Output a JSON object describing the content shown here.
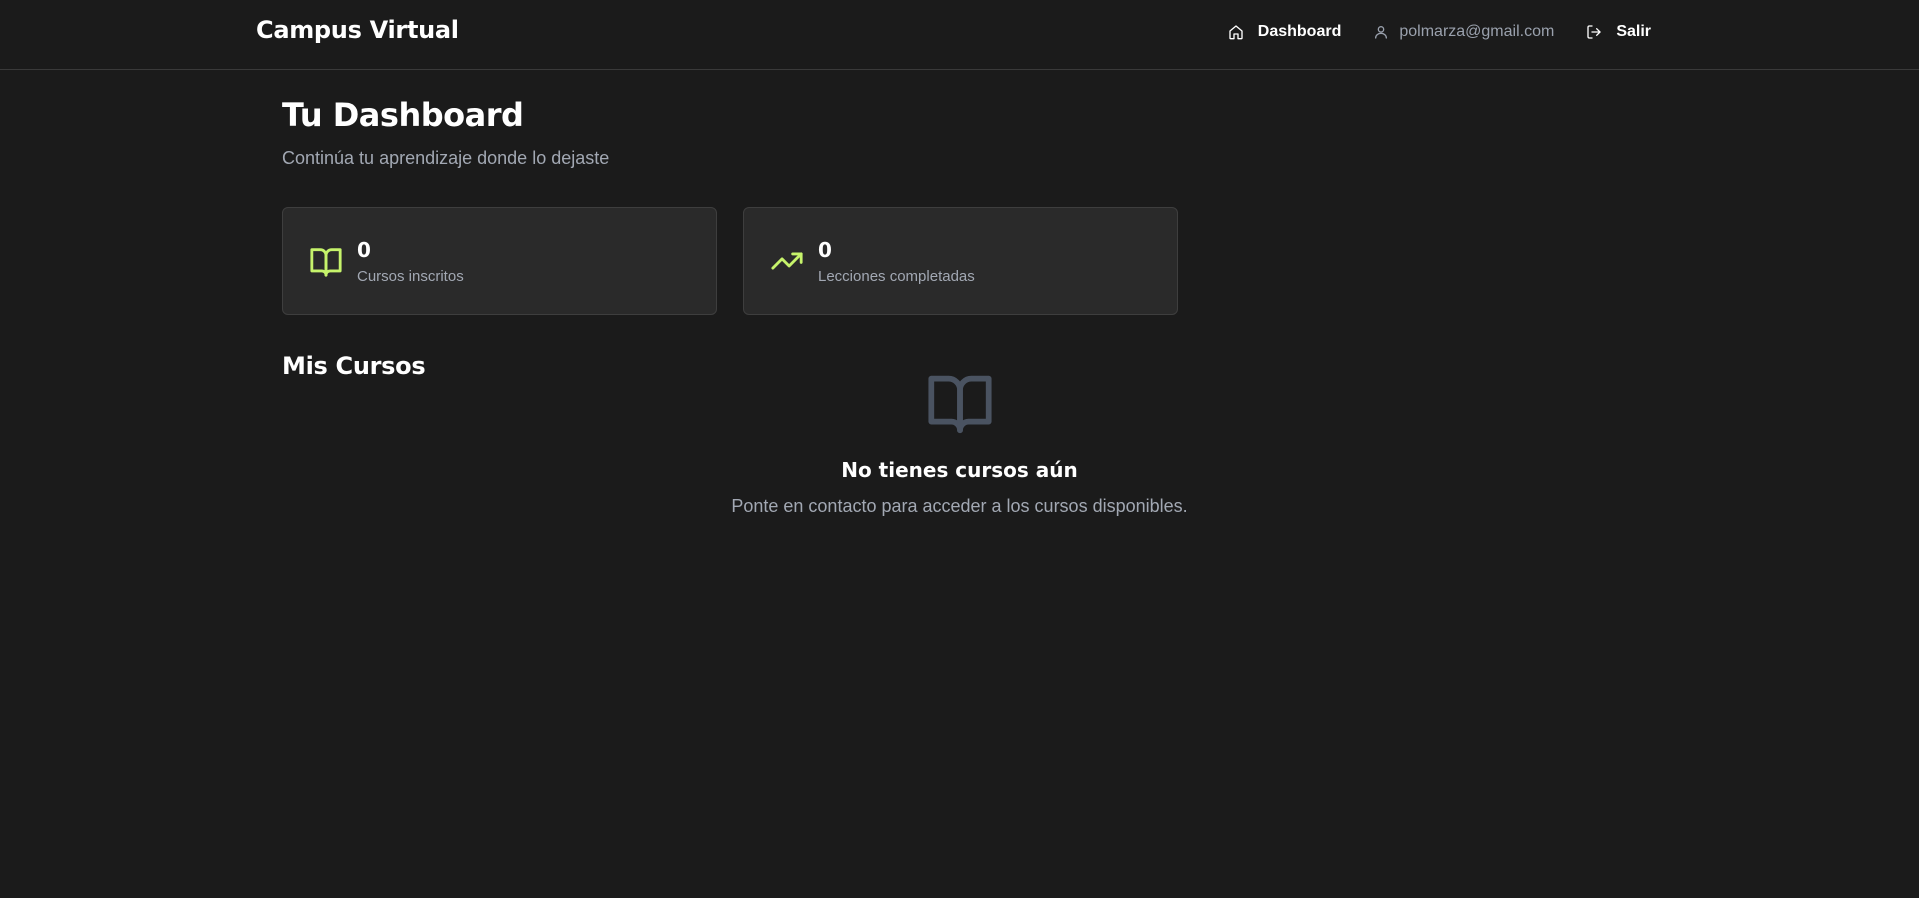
{
  "header": {
    "brand": "Campus Virtual",
    "nav": {
      "dashboard_label": "Dashboard",
      "user_email": "polmarza@gmail.com",
      "logout_label": "Salir"
    }
  },
  "main": {
    "title": "Tu Dashboard",
    "subtitle": "Continúa tu aprendizaje donde lo dejaste",
    "stats": [
      {
        "value": "0",
        "label": "Cursos inscritos",
        "icon": "book-open-icon"
      },
      {
        "value": "0",
        "label": "Lecciones completadas",
        "icon": "trending-up-icon"
      }
    ],
    "section_title": "Mis Cursos",
    "empty_state": {
      "icon": "book-open-icon",
      "title": "No tienes cursos aún",
      "text": "Ponte en contacto para acceder a los cursos disponibles."
    }
  },
  "colors": {
    "background": "#1b1b1b",
    "card": "#2a2a2a",
    "accent": "#c6f36b",
    "muted_text": "#a2a8b3",
    "empty_icon": "#4a5361"
  }
}
